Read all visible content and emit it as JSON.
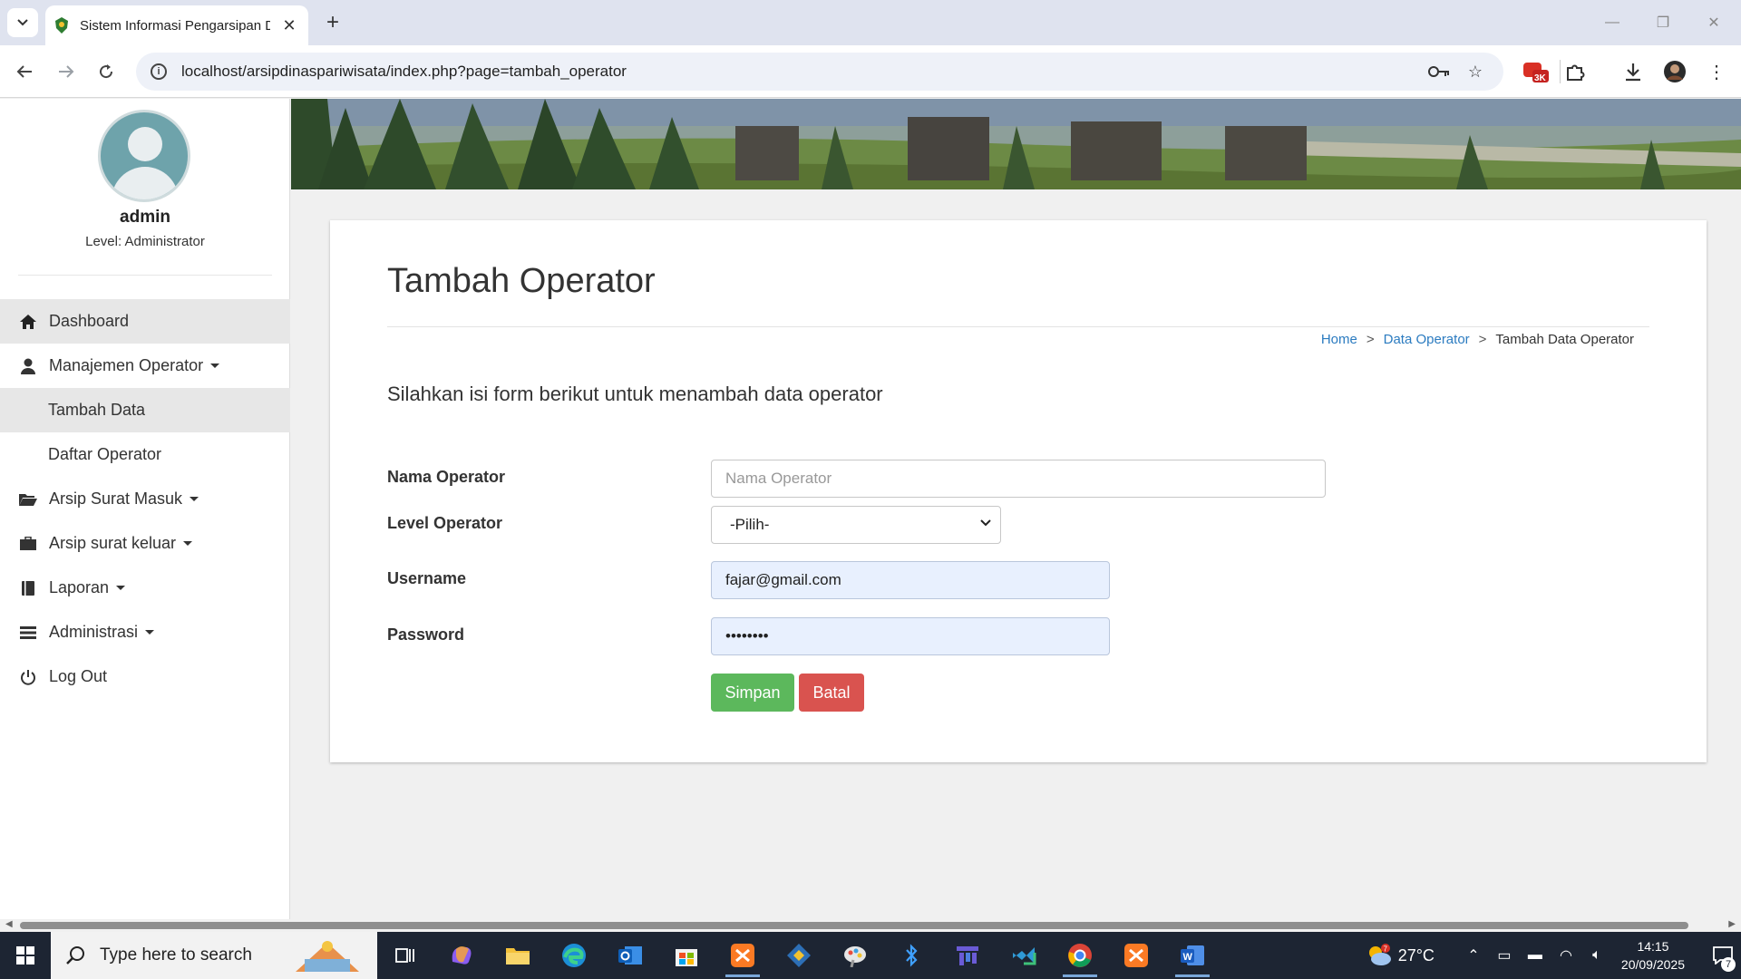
{
  "browser": {
    "tab_title": "Sistem Informasi Pengarsipan D",
    "url": "localhost/arsipdinaspariwisata/index.php?page=tambah_operator",
    "extension_badge": "3K"
  },
  "sidebar": {
    "user_name": "admin",
    "user_level": "Level: Administrator",
    "menu": [
      {
        "label": "Dashboard",
        "icon": "home-icon"
      },
      {
        "label": "Manajemen Operator",
        "icon": "user-icon"
      },
      {
        "label": "Tambah Data"
      },
      {
        "label": "Daftar Operator"
      },
      {
        "label": "Arsip Surat Masuk",
        "icon": "folder-open-icon"
      },
      {
        "label": "Arsip surat keluar",
        "icon": "briefcase-icon"
      },
      {
        "label": "Laporan",
        "icon": "book-icon"
      },
      {
        "label": "Administrasi",
        "icon": "list-icon"
      },
      {
        "label": "Log Out",
        "icon": "power-icon"
      }
    ]
  },
  "main": {
    "title": "Tambah Operator",
    "breadcrumb": {
      "home": "Home",
      "parent": "Data Operator",
      "current": "Tambah Data Operator",
      "separator": ">"
    },
    "intro": "Silahkan isi form berikut untuk menambah data operator",
    "form": {
      "nama_label": "Nama Operator",
      "nama_placeholder": "Nama Operator",
      "level_label": "Level Operator",
      "level_value": "-Pilih-",
      "username_label": "Username",
      "username_value": "fajar@gmail.com",
      "password_label": "Password",
      "password_value": "••••••••"
    },
    "buttons": {
      "save": "Simpan",
      "cancel": "Batal"
    },
    "colors": {
      "save": "#5cb85c",
      "cancel": "#d9534f",
      "link": "#2b7bc0"
    }
  },
  "taskbar": {
    "search_placeholder": "Type here to search",
    "temperature": "27°C",
    "weather_badge": "7",
    "time": "14:15",
    "date": "20/09/2025",
    "notification_count": "7"
  }
}
